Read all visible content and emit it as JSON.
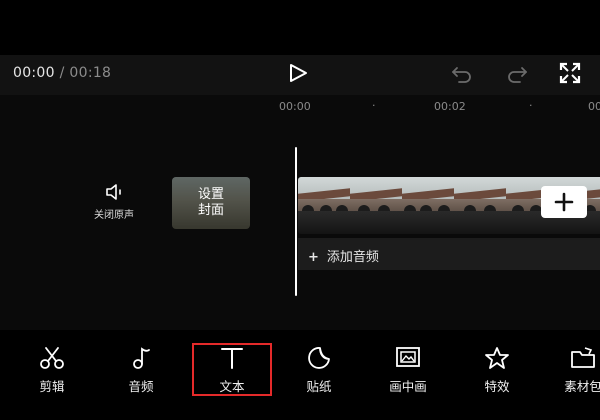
{
  "playback": {
    "current_time": "00:00",
    "separator": "/",
    "total_time": "00:18"
  },
  "icons": {
    "play": "play-icon",
    "undo": "undo-icon",
    "redo": "redo-icon",
    "fullscreen": "fullscreen-icon",
    "mute": "speaker-icon",
    "add": "plus-icon"
  },
  "ruler": {
    "labels": [
      "00:00",
      "00:02",
      "00"
    ],
    "dot": "·"
  },
  "track": {
    "mute_label": "关闭原声",
    "cover_label": "设置\n封面",
    "add_audio_label": "添加音频"
  },
  "toolbar": {
    "items": [
      {
        "label": "剪辑",
        "icon": "scissors-icon"
      },
      {
        "label": "音频",
        "icon": "music-note-icon"
      },
      {
        "label": "文本",
        "icon": "text-icon",
        "selected": true
      },
      {
        "label": "贴纸",
        "icon": "sticker-icon"
      },
      {
        "label": "画中画",
        "icon": "picture-in-picture-icon"
      },
      {
        "label": "特效",
        "icon": "effects-star-icon"
      },
      {
        "label": "素材包",
        "icon": "material-pack-icon"
      }
    ]
  },
  "colors": {
    "background": "#000000",
    "highlight": "#e52a2a",
    "playhead": "#ffffff"
  }
}
